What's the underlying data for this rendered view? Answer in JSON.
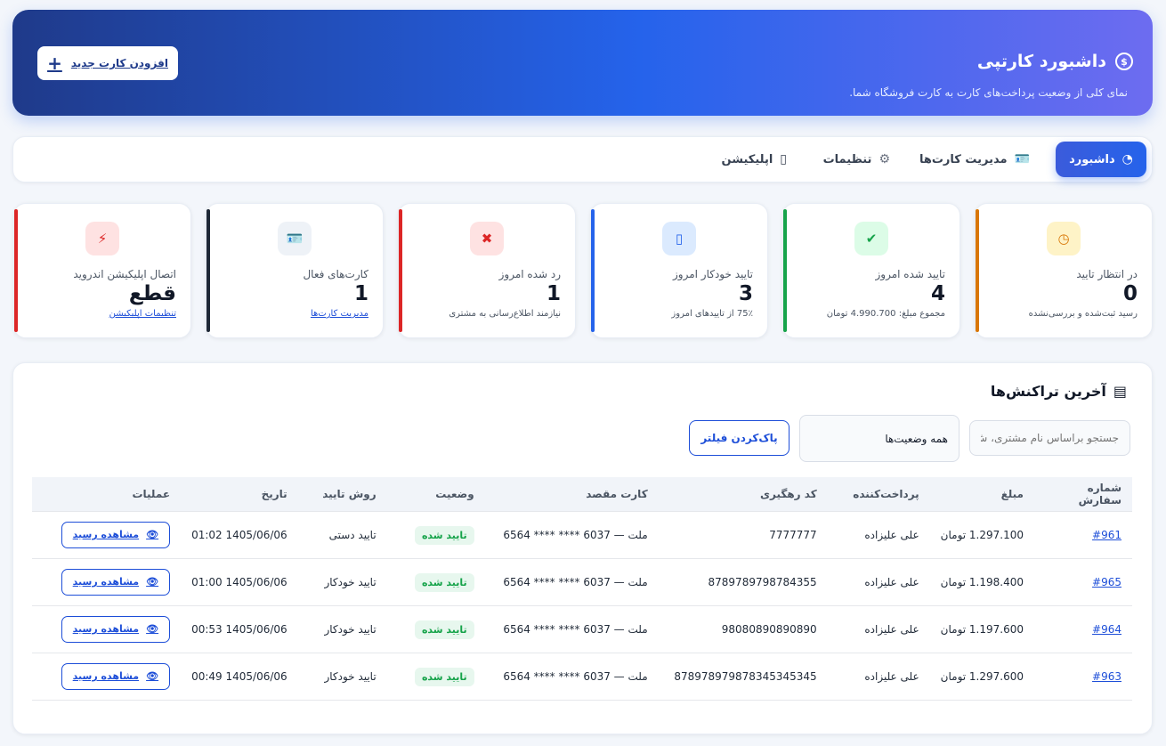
{
  "header": {
    "title": "داشبورد کارتپی",
    "subtitle": "نمای کلی از وضعیت پرداخت‌های کارت به کارت فروشگاه شما.",
    "add_button_label": "افزودن کارت جدید"
  },
  "nav": {
    "tabs": [
      {
        "label": "داشبورد",
        "icon": "gauge-icon"
      },
      {
        "label": "مدیریت کارت‌ها",
        "icon": "id-card-icon"
      },
      {
        "label": "تنظیمات",
        "icon": "gear-icon"
      },
      {
        "label": "اپلیکیشن",
        "icon": "mobile-icon"
      }
    ]
  },
  "stats": [
    {
      "label": "در انتظار تایید",
      "value": "0",
      "sub": "رسید ثبت‌شده و بررسی‌نشده",
      "color": "#d97706",
      "icon": "clock-icon"
    },
    {
      "label": "تایید شده امروز",
      "value": "4",
      "sub": "مجموع مبلغ: 4.990.700 تومان",
      "color": "#16a34a",
      "icon": "check-circle-icon"
    },
    {
      "label": "تایید خودکار امروز",
      "value": "3",
      "sub": "75٪ از تاییدهای امروز",
      "color": "#2563eb",
      "icon": "mobile-icon"
    },
    {
      "label": "رد شده امروز",
      "value": "1",
      "sub": "نیازمند اطلاع‌رسانی به مشتری",
      "color": "#dc2626",
      "icon": "x-circle-icon"
    },
    {
      "label": "کارت‌های فعال",
      "value": "1",
      "sub": "مدیریت کارت‌ها",
      "color": "#1f2937",
      "icon": "id-card-icon"
    },
    {
      "label": "اتصال اپلیکیشن اندروید",
      "value": "قطع",
      "sub": "تنظیمات اپلیکیشن",
      "color": "#dc2626",
      "icon": "unplug-icon"
    }
  ],
  "transactions": {
    "title": "آخرین تراکنش‌ها",
    "search_placeholder": "جستجو براساس نام مشتری، ش",
    "status_filter": "همه وضعیت‌ها",
    "clear_filter_label": "پاک‌کردن فیلتر",
    "columns": [
      "شماره سفارش",
      "مبلغ",
      "پرداخت‌کننده",
      "کد رهگیری",
      "کارت مقصد",
      "وضعیت",
      "روش تایید",
      "تاریخ",
      "عملیات"
    ],
    "rows": [
      {
        "order": "#961",
        "amount": "1.297.100 تومان",
        "payer": "علی علیزاده",
        "tracking": "7777777",
        "card": "ملت — 6037 **** **** 6564",
        "status": "تایید شده",
        "method": "تایید دستی",
        "date": "1405/06/06 01:02",
        "action": "مشاهده رسید"
      },
      {
        "order": "#965",
        "amount": "1.198.400 تومان",
        "payer": "علی علیزاده",
        "tracking": "8789789798784355",
        "card": "ملت — 6037 **** **** 6564",
        "status": "تایید شده",
        "method": "تایید خودکار",
        "date": "1405/06/06 01:00",
        "action": "مشاهده رسید"
      },
      {
        "order": "#964",
        "amount": "1.197.600 تومان",
        "payer": "علی علیزاده",
        "tracking": "98080890890890",
        "card": "ملت — 6037 **** **** 6564",
        "status": "تایید شده",
        "method": "تایید خودکار",
        "date": "1405/06/06 00:53",
        "action": "مشاهده رسید"
      },
      {
        "order": "#963",
        "amount": "1.297.600 تومان",
        "payer": "علی علیزاده",
        "tracking": "878978979878345345345",
        "card": "ملت — 6037 **** **** 6564",
        "status": "تایید شده",
        "method": "تایید خودکار",
        "date": "1405/06/06 00:49",
        "action": "مشاهده رسید"
      }
    ]
  }
}
